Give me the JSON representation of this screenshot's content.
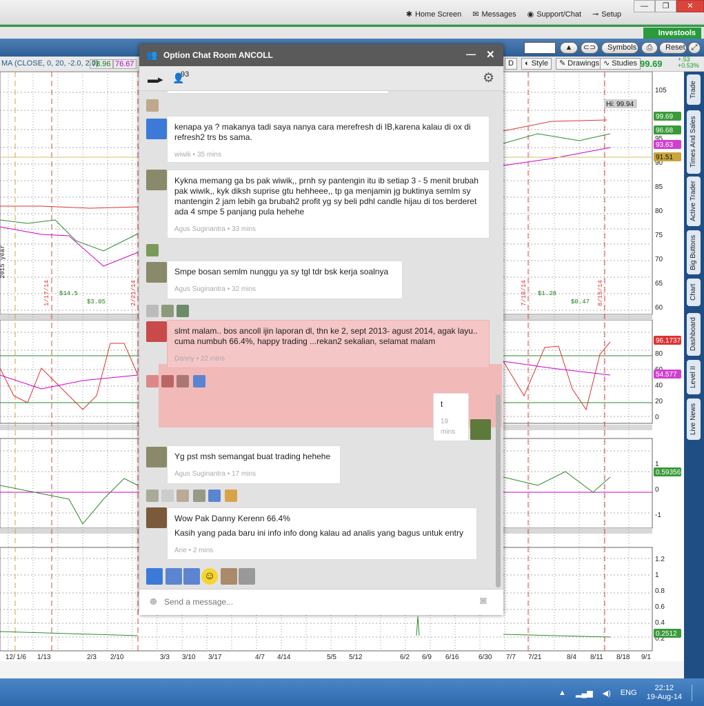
{
  "topnav": {
    "home": "Home Screen",
    "messages": "Messages",
    "support": "Support/Chat",
    "setup": "Setup"
  },
  "window_controls": {
    "minimize": "—",
    "restore": "❐",
    "close": "✕"
  },
  "brand": "Investools",
  "toolbar": {
    "symbols": "Symbols",
    "reset": "Reset"
  },
  "studybar": {
    "study_label": "MA (CLOSE, 0, 20, -2.0, 2.0)",
    "v1": "78.96",
    "v2": "76.67",
    "d": "D",
    "style": "Style",
    "drawings": "Drawings",
    "studies": "Studies",
    "price": "99.69",
    "chg1": "+.53",
    "chg2": "+0.53%"
  },
  "side_tabs": [
    "Trade",
    "Times And Sales",
    "Active Trader",
    "Big Buttons",
    "Chart",
    "Dashboard",
    "Level II",
    "Live News"
  ],
  "price_axis": {
    "main": [
      "105",
      "100",
      "95",
      "90",
      "85",
      "80",
      "75",
      "70",
      "65",
      "60"
    ],
    "rsi": [
      "80",
      "60",
      "40",
      "20",
      "0"
    ],
    "macd": [
      "1",
      "0",
      "-1"
    ],
    "vol": [
      "1.2",
      "1",
      "0.8",
      "0.6",
      "0.4",
      "0.2"
    ]
  },
  "badges": {
    "hi": "Hi: 99.94",
    "b1": "99.69",
    "b2": "96.68",
    "b3": "93.63",
    "b4": "91.51",
    "rsi": "96.1737",
    "rsi2": "54.577",
    "macd": "0.59356",
    "vol": "0.2512"
  },
  "date_axis": [
    "12/",
    "1/6",
    "1/13",
    "2/3",
    "2/10",
    "3/3",
    "3/10",
    "3/17",
    "4/7",
    "4/14",
    "5/5",
    "5/12",
    "6/2",
    "6/9",
    "6/16",
    "6/30",
    "7/7",
    "7/21",
    "8/4",
    "8/11",
    "8/18",
    "9/1"
  ],
  "chart_marks": {
    "year": "2015 year",
    "e1": "1/17/14",
    "e2": "2/21/14",
    "e3": "7/18/14",
    "e4": "8/15/14",
    "div1": "$14.5",
    "div2": "$3.05",
    "div3": "$1.28",
    "div4": "$0.47"
  },
  "chat": {
    "title": "Option Chat Room ANCOLL",
    "participants": "93",
    "input_placeholder": "Send a message...",
    "messages": [
      {
        "text": "kenapa ya ? makanya tadi saya nanya cara merefresh di IB,karena kalau di ox di refresh2 trs bs sama.",
        "meta": "wiwik • 35 mins"
      },
      {
        "text": "Kykna memang ga bs pak wiwik,, prnh sy pantengin itu ib setiap 3 - 5 menit brubah pak wiwik,, kyk diksh suprise gtu hehheee,, tp ga menjamin jg buktinya semlm sy mantengin 2 jam lebih ga brubah2 profit yg sy beli pdhl candle hijau di tos berderet ada 4 smpe 5 panjang pula hehehe",
        "meta": "Agus Suginantra • 33 mins"
      },
      {
        "text": "Smpe bosan semlm nunggu ya sy tgl tdr bsk kerja soalnya",
        "meta": "Agus Suginantra • 32 mins"
      },
      {
        "text": "slmt malam.. bos ancoll ijin laporan dl, thn ke 2, sept 2013- agust 2014, agak layu.. cuma numbuh 66.4%, happy trading ...rekan2 sekalian, selamat malam",
        "meta": "Danny • 22 mins"
      },
      {
        "text": "t",
        "meta": "19 mins"
      },
      {
        "text": "Yg pst msh semangat buat trading hehehe",
        "meta": "Agus Suginantra • 17 mins"
      },
      {
        "text": "Wow Pak Danny Kerenn 66.4%",
        "text2": "Kasih yang pada baru ini info info dong kalau ad analis yang bagus untuk entry",
        "meta": "Arie • 2 mins"
      }
    ]
  },
  "tray": {
    "lang": "ENG",
    "time": "22:12",
    "date": "19-Aug-14"
  }
}
